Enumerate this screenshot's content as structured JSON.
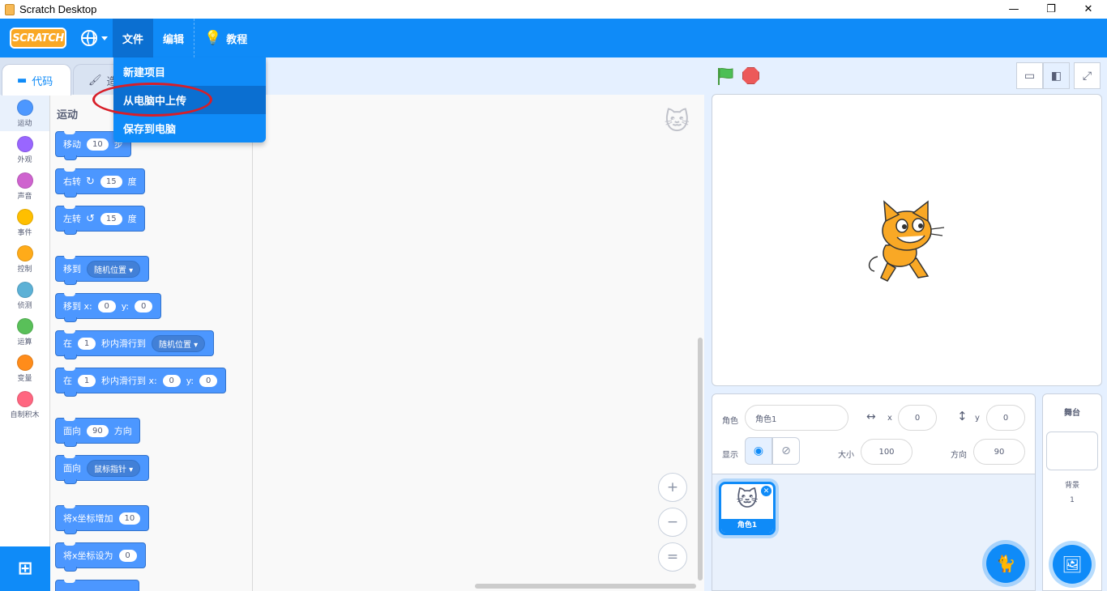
{
  "window": {
    "title": "Scratch Desktop",
    "controls": [
      "—",
      "❐",
      "✕"
    ]
  },
  "menubar": {
    "logo": "SCRATCH",
    "file": "文件",
    "edit": "编辑",
    "tutorials": "教程"
  },
  "file_menu": {
    "items": [
      "新建项目",
      "从电脑中上传",
      "保存到电脑"
    ],
    "highlighted_index": 1,
    "annotation": "red ellipse around 从电脑中上传"
  },
  "tabs": {
    "code": "代码",
    "costumes": "造"
  },
  "categories": [
    {
      "label": "运动",
      "color": "#4c97ff"
    },
    {
      "label": "外观",
      "color": "#9966ff"
    },
    {
      "label": "声音",
      "color": "#cf63cf"
    },
    {
      "label": "事件",
      "color": "#ffbf00"
    },
    {
      "label": "控制",
      "color": "#ffab19"
    },
    {
      "label": "侦测",
      "color": "#5cb1d6"
    },
    {
      "label": "运算",
      "color": "#59c059"
    },
    {
      "label": "变量",
      "color": "#ff8c1a"
    },
    {
      "label": "自制积木",
      "color": "#ff6680"
    }
  ],
  "palette": {
    "heading": "运动",
    "blocks": {
      "move": {
        "a": "移动",
        "v": "10",
        "b": "步"
      },
      "turn_right": {
        "a": "右转",
        "v": "15",
        "b": "度"
      },
      "turn_left": {
        "a": "左转",
        "v": "15",
        "b": "度"
      },
      "goto": {
        "a": "移到",
        "d": "随机位置"
      },
      "goto_xy": {
        "a": "移到 x:",
        "x": "0",
        "b": "y:",
        "y": "0"
      },
      "glide": {
        "a": "在",
        "v": "1",
        "b": "秒内滑行到",
        "d": "随机位置"
      },
      "glide_xy": {
        "a": "在",
        "v": "1",
        "b": "秒内滑行到 x:",
        "x": "0",
        "c": "y:",
        "y": "0"
      },
      "point_dir": {
        "a": "面向",
        "v": "90",
        "b": "方向"
      },
      "point_towards": {
        "a": "面向",
        "d": "鼠标指针"
      },
      "change_x": {
        "a": "将x坐标增加",
        "v": "10"
      },
      "set_x": {
        "a": "将x坐标设为",
        "v": "0"
      }
    }
  },
  "zoom": {
    "in": "+",
    "out": "−",
    "reset": "="
  },
  "sprite_info": {
    "sprite_label": "角色",
    "sprite_name": "角色1",
    "x_label": "x",
    "x_value": "0",
    "y_label": "y",
    "y_value": "0",
    "show_label": "显示",
    "size_label": "大小",
    "size_value": "100",
    "direction_label": "方向",
    "direction_value": "90"
  },
  "sprites": [
    {
      "name": "角色1"
    }
  ],
  "stage_panel": {
    "title": "舞台",
    "backdrops_label": "背景",
    "backdrops_count": "1"
  },
  "colors": {
    "accent": "#0f8bf8",
    "motion": "#4c97ff",
    "annotation": "#d81e28"
  }
}
